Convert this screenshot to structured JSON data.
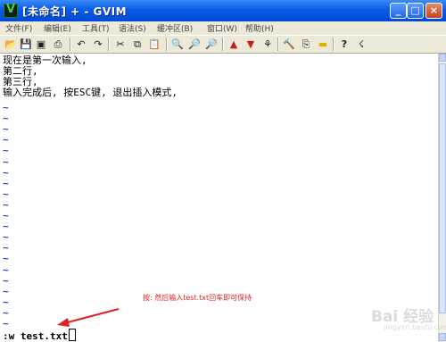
{
  "window": {
    "title": "[未命名] + - GVIM",
    "buttons": {
      "minimize": "_",
      "maximize": "□",
      "close": "×"
    }
  },
  "menubar": {
    "items": [
      "文件(F)",
      "编辑(E)",
      "工具(T)",
      "语法(S)",
      "缓冲区(B)",
      "窗口(W)",
      "帮助(H)"
    ]
  },
  "toolbar": {
    "icons": [
      "open-icon",
      "save-icon",
      "save-all-icon",
      "print-icon",
      "undo-icon",
      "redo-icon",
      "cut-icon",
      "copy-icon",
      "paste-icon",
      "find-replace-icon",
      "find-next-icon",
      "find-prev-icon",
      "load-session-icon",
      "save-session-icon",
      "run-script-icon",
      "make-icon",
      "shell-icon",
      "ctags-icon",
      "help-icon",
      "find-help-icon"
    ]
  },
  "editor": {
    "lines": [
      "现在是第一次输入,",
      "第二行,",
      "第三行,",
      "输入完成后, 按ESC键, 退出插入模式,"
    ],
    "command_line": ":w test.txt"
  },
  "annotation": {
    "text": "按: 然后输入test.txt回车即可保持",
    "color": "#e02020"
  },
  "watermark": {
    "text": "Bai 经验",
    "sub": "jingyan.baidu.com"
  },
  "colors": {
    "tilde": "#1a3fd4",
    "titlebar": "#0a5ce8",
    "chrome": "#ece9d8"
  }
}
